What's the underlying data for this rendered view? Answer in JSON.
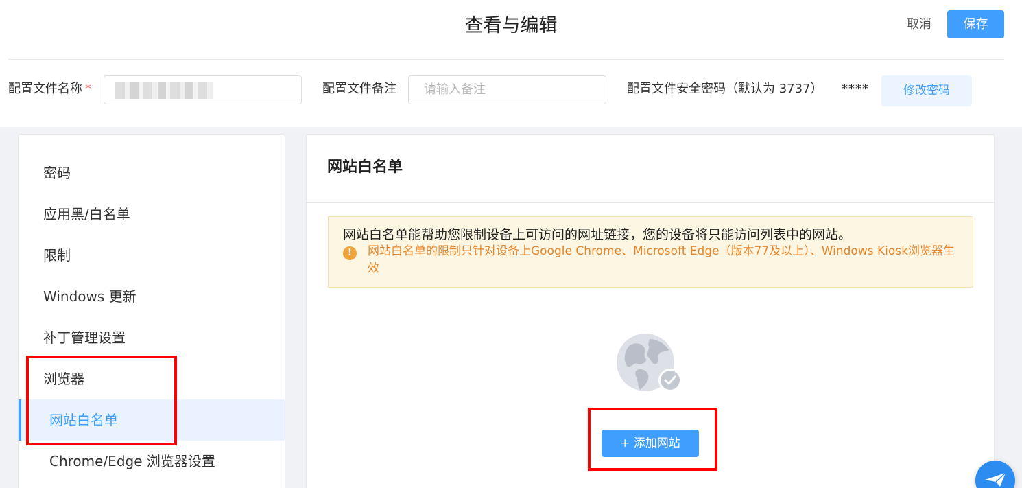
{
  "header": {
    "title": "查看与编辑",
    "cancel_label": "取消",
    "save_label": "保存"
  },
  "form": {
    "name_label": "配置文件名称",
    "required_mark": "*",
    "remark_label": "配置文件备注",
    "remark_placeholder": "请输入备注",
    "password_label": "配置文件安全密码（默认为 3737）",
    "password_mask": "****",
    "change_password_label": "修改密码"
  },
  "sidebar": {
    "items": [
      {
        "label": "密码"
      },
      {
        "label": "应用黑/白名单"
      },
      {
        "label": "限制"
      },
      {
        "label": "Windows 更新"
      },
      {
        "label": "补丁管理设置"
      },
      {
        "label": "浏览器"
      },
      {
        "label": "网站白名单",
        "active": true
      },
      {
        "label": "Chrome/Edge 浏览器设置"
      }
    ]
  },
  "main": {
    "title": "网站白名单",
    "notice_text": "网站白名单能帮助您限制设备上可访问的网址链接，您的设备将只能访问列表中的网站。",
    "notice_warning": "网站白名单的限制只针对设备上Google Chrome、Microsoft Edge（版本77及以上）、Windows Kiosk浏览器生效",
    "warning_icon": "!",
    "add_button_label": "+ 添加网站"
  },
  "colors": {
    "primary": "#409eff",
    "highlight_box": "#ff0000",
    "warning": "#e6862c"
  },
  "icons": {
    "empty_state": "globe-check-icon",
    "fab": "send-icon"
  }
}
